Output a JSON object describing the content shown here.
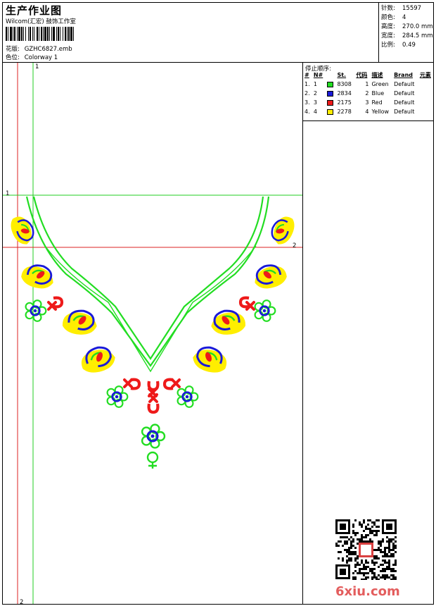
{
  "header": {
    "title": "生产作业图",
    "company": "Wilcom(汇宏) 鼓饰工作室",
    "design_label": "花版:",
    "design_value": "GZHC6827.emb",
    "colorway_label": "色位:",
    "colorway_value": "Colorway 1"
  },
  "stats": {
    "stitches_label": "针数:",
    "stitches_value": "15597",
    "colors_label": "颜色:",
    "colors_value": "4",
    "height_label": "高度:",
    "height_value": "270.0 mm",
    "width_label": "宽度:",
    "width_value": "284.5 mm",
    "scale_label": "比例:",
    "scale_value": "0.49"
  },
  "stop_sequence": {
    "heading": "停止顺序:",
    "columns": [
      "#",
      "N#",
      "St.",
      "代码",
      "描述",
      "Brand",
      "元素"
    ],
    "rows": [
      {
        "idx": "1.",
        "n": "1",
        "color": "#22dd22",
        "st": "8308",
        "code": "1",
        "desc": "Green",
        "brand": "Default"
      },
      {
        "idx": "2.",
        "n": "2",
        "color": "#1a1ad8",
        "st": "2834",
        "code": "2",
        "desc": "Blue",
        "brand": "Default"
      },
      {
        "idx": "3.",
        "n": "3",
        "color": "#ee1a1a",
        "st": "2175",
        "code": "3",
        "desc": "Red",
        "brand": "Default"
      },
      {
        "idx": "4.",
        "n": "4",
        "color": "#ffee00",
        "st": "2278",
        "code": "4",
        "desc": "Yellow",
        "brand": "Default"
      }
    ]
  },
  "guides": {
    "green_top": "1",
    "green_left": "1",
    "red_right": "2",
    "red_bottom": "2"
  },
  "colors": {
    "green": "#22dd22",
    "blue": "#1a1ad8",
    "red": "#ee1a1a",
    "yellow": "#ffee00",
    "guide_green": "#22cc22",
    "guide_red": "#dd2222"
  },
  "watermark": "6xiu.com"
}
